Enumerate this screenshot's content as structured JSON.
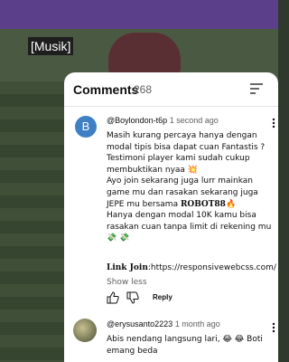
{
  "video": {
    "caption": "[Musik]"
  },
  "comments_panel": {
    "title": "Comments",
    "count": "268",
    "sort_icon": "sort-icon",
    "comments": [
      {
        "avatar_letter": "B",
        "avatar_color": "#3f7fc4",
        "author": "@Boylondon-t6p",
        "time": "1 second ago",
        "body_pre": "Masih kurang percaya hanya dengan modal tipis bisa dapat cuan Fantastis ? Testimoni player kami sudah cukup membuktikan nyaa 💥\nAyo join sekarang juga lurr mainkan game mu dan rasakan sekarang juga JEPE mu bersama ",
        "body_bold": "𝐑𝐎𝐁𝐎𝐓𝟖𝟖",
        "body_post": "🔥\nHanya dengan modal 10K kamu bisa rasakan cuan tanpa limit di rekening mu 💸 💸",
        "link_label": "𝐋𝐢𝐧𝐤 𝐉𝐨𝐢𝐧",
        "link_url": ":https://responsivewebcss.com/",
        "show_less": "Show less",
        "reply_label": "Reply"
      },
      {
        "author": "@erysusanto2223",
        "time": "1 month ago",
        "body": "Abis nendang langsung lari, 😂 😂 Boti emang beda"
      }
    ]
  }
}
